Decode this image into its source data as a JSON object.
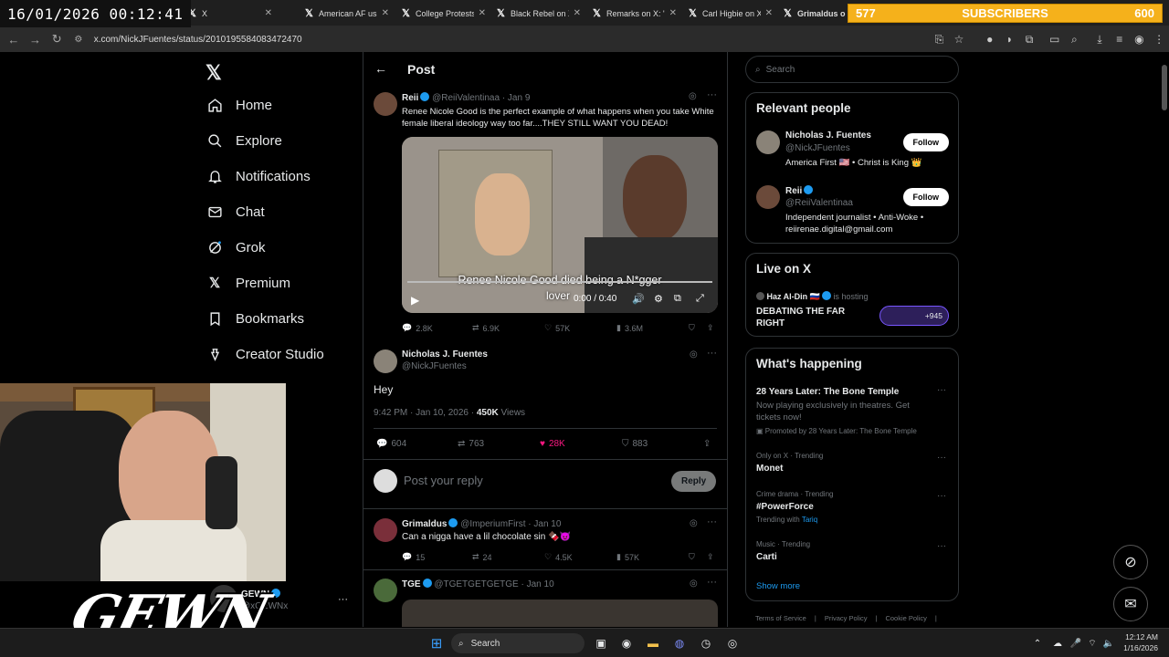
{
  "overlay": {
    "timestamp": "16/01/2026 00:12:41",
    "subscribers_left": "577",
    "subscribers_label": "SUBSCRIBERS",
    "subscribers_right": "600"
  },
  "tabs": [
    {
      "title": "X"
    },
    {
      "title": "American AF us"
    },
    {
      "title": "College Protests"
    },
    {
      "title": "Black Rebel on X"
    },
    {
      "title": "Remarks on X: \""
    },
    {
      "title": "Carl Higbie on X"
    },
    {
      "title": "Grimaldus on"
    }
  ],
  "address": {
    "url": "x.com/NickJFuentes/status/2010195584083472470"
  },
  "nav": {
    "items": [
      {
        "label": "Home"
      },
      {
        "label": "Explore"
      },
      {
        "label": "Notifications"
      },
      {
        "label": "Chat"
      },
      {
        "label": "Grok"
      },
      {
        "label": "Premium"
      },
      {
        "label": "Bookmarks"
      },
      {
        "label": "Creator Studio"
      }
    ],
    "account_name": "GEWN",
    "account_handle": "@xGEWNx",
    "more": "···"
  },
  "header": {
    "back": "←",
    "title": "Post"
  },
  "quoted": {
    "name": "Reii",
    "handle": "@ReiiValentinaa",
    "date": "· Jan 9",
    "text": "Renee Nicole Good is the perfect example of what happens when you take White female liberal ideology way too far....THEY STILL WANT YOU DEAD!",
    "caption_line1": "Renee Nicole Good died being a N*gger",
    "caption_line2": "lover",
    "video_time": "0:00 / 0:40",
    "stats": {
      "replies": "2.8K",
      "reposts": "6.9K",
      "likes": "57K",
      "views": "3.6M"
    }
  },
  "main_post": {
    "name": "Nicholas J. Fuentes",
    "handle": "@NickJFuentes",
    "text": "Hey",
    "meta": "9:42 PM · Jan 10, 2026 ·",
    "views_count": "450K",
    "views_label": "Views",
    "stats": {
      "replies": "604",
      "reposts": "763",
      "likes": "28K",
      "bookmarks": "883"
    }
  },
  "reply_box": {
    "placeholder": "Post your reply",
    "button": "Reply"
  },
  "replies": [
    {
      "name": "Grimaldus",
      "handle": "@ImperiumFirst",
      "date": "· Jan 10",
      "text": "Can a nigga have a lil chocolate sin 🍫😈",
      "stats": {
        "replies": "15",
        "reposts": "24",
        "likes": "4.5K",
        "views": "57K"
      }
    },
    {
      "name": "TGE",
      "handle": "@TGETGETGETGE",
      "date": "· Jan 10"
    }
  ],
  "search": {
    "placeholder": "Search"
  },
  "relevant": {
    "title": "Relevant people",
    "people": [
      {
        "name": "Nicholas J. Fuentes",
        "handle": "@NickJFuentes",
        "bio": "America First 🇺🇸 • Christ is King 👑",
        "follow": "Follow"
      },
      {
        "name": "Reii",
        "handle": "@ReiiValentinaa",
        "bio": "Independent journalist • Anti-Woke •",
        "bio2": "reiirenae.digital@gmail.com",
        "follow": "Follow"
      }
    ]
  },
  "live": {
    "title": "Live on X",
    "host": "Haz Al-Din",
    "hosting": "is hosting",
    "space": "DEBATING THE FAR RIGHT",
    "count": "+945"
  },
  "happening": {
    "title": "What's happening",
    "promo_title": "28 Years Later: The Bone Temple",
    "promo_text": "Now playing exclusively in theatres. Get tickets now!",
    "promo_by": "Promoted by 28 Years Later: The Bone Temple",
    "trends": [
      {
        "context": "Only on X · Trending",
        "topic": "Monet",
        "extra": ""
      },
      {
        "context": "Crime drama · Trending",
        "topic": "#PowerForce",
        "extra_label": "Trending with",
        "extra": "Tariq"
      },
      {
        "context": "Music · Trending",
        "topic": "Carti",
        "extra": ""
      }
    ],
    "show_more": "Show more"
  },
  "footer": {
    "terms": "Terms of Service",
    "privacy": "Privacy Policy",
    "cookie": "Cookie Policy"
  },
  "taskbar": {
    "search": "Search",
    "time": "12:12 AM",
    "date": "1/16/2026"
  },
  "stream": {
    "logo": "GEWN"
  },
  "colors": {
    "accent": "#1d9bf0",
    "like": "#f91880",
    "subbar": "#f5b11b"
  }
}
